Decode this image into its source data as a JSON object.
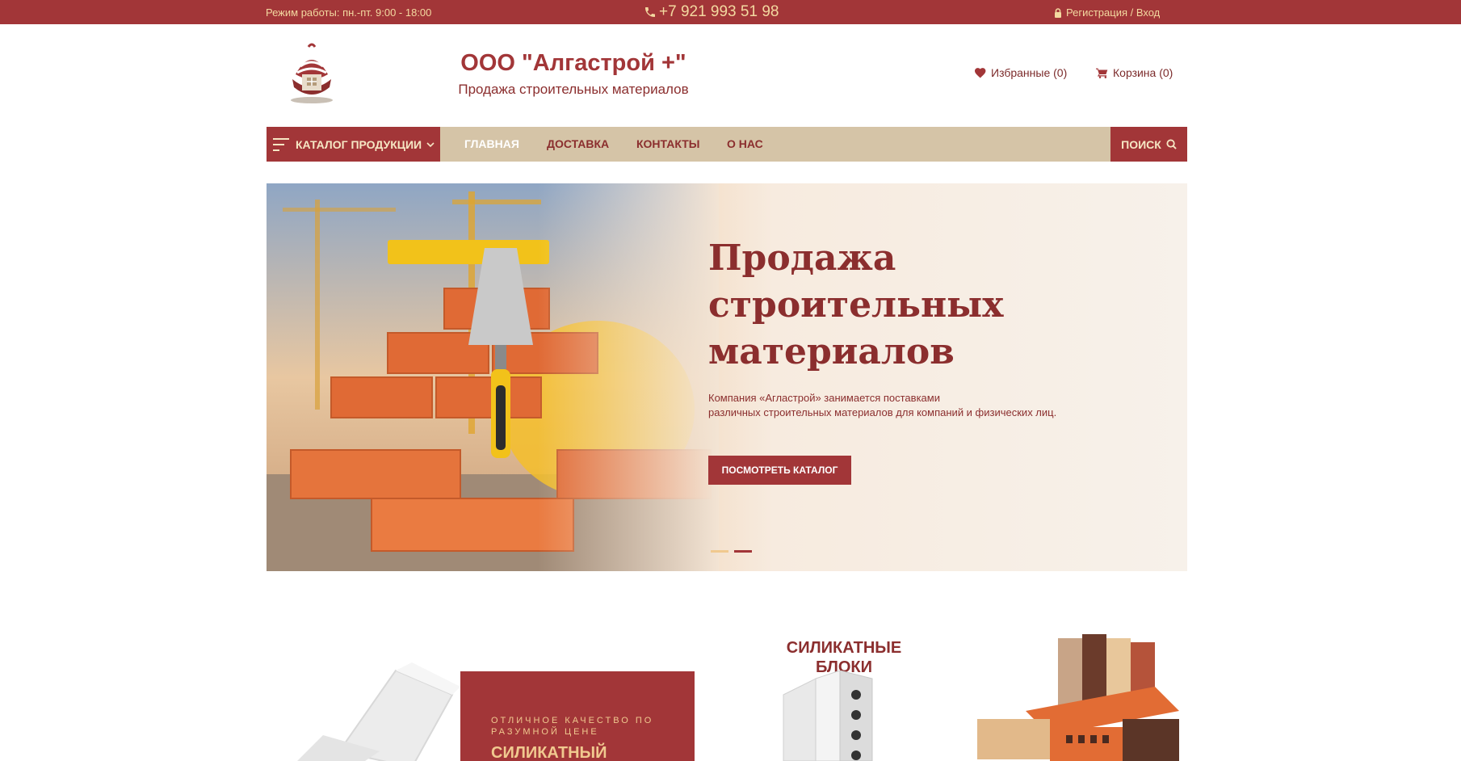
{
  "topbar": {
    "hours": "Режим работы: пн.-пт. 9:00 - 18:00",
    "phone": "+7 921 993 51 98",
    "auth": "Регистрация / Вход"
  },
  "header": {
    "company_name": "ООО \"Алгастрой +\"",
    "tagline": "Продажа строительных материалов",
    "favorites": "Избранные (0)",
    "cart": "Корзина (0)"
  },
  "nav": {
    "catalog": "КАТАЛОГ ПРОДУКЦИИ",
    "links": [
      "ГЛАВНАЯ",
      "ДОСТАВКА",
      "КОНТАКТЫ",
      "О НАС"
    ],
    "search": "ПОИСК"
  },
  "hero": {
    "title_lines": [
      "Продажа",
      "строительных",
      "материалов"
    ],
    "desc_lines": [
      "Компания «Агластрой» занимается поставками",
      "различных строительных материалов для компаний и физических лиц."
    ],
    "button": "ПОСМОТРЕТЬ КАТАЛОГ",
    "slides_total": 2,
    "active_slide": 2
  },
  "promo": {
    "subtitle_lines": [
      "ОТЛИЧНОЕ КАЧЕСТВО ПО",
      "РАЗУМНОЙ ЦЕНЕ"
    ],
    "title": "СИЛИКАТНЫЙ"
  },
  "products": {
    "blocks_title_lines": [
      "СИЛИКАТНЫЕ",
      "БЛОКИ"
    ]
  },
  "colors": {
    "primary": "#a23638",
    "beige": "#d5c4a7",
    "accent_text": "#f3d9a0"
  }
}
